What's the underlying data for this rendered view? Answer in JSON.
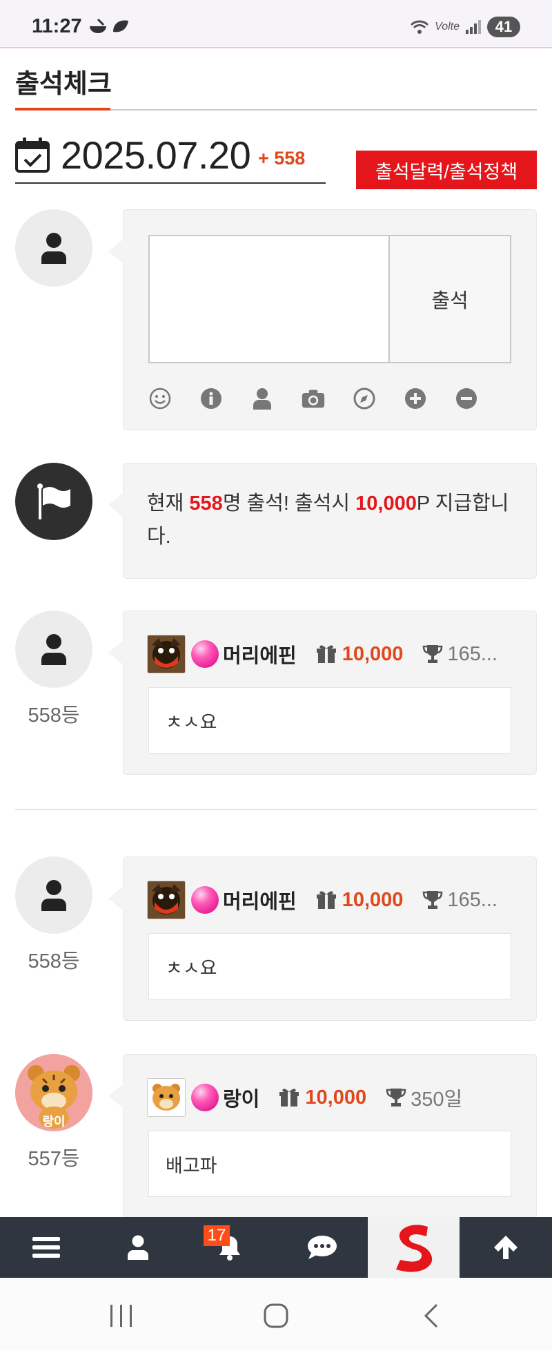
{
  "status_bar": {
    "time": "11:27",
    "volte": "Volte",
    "battery": "41"
  },
  "page": {
    "title": "출석체크",
    "date": "2025.07.20",
    "attend_count": "+ 558",
    "policy_button": "출석달력/출석정책"
  },
  "input": {
    "textarea_value": "",
    "submit_label": "출석",
    "tools": [
      "emoji-icon",
      "info-icon",
      "user-icon",
      "camera-icon",
      "compass-icon",
      "plus-circle-icon",
      "minus-circle-icon"
    ]
  },
  "notice": {
    "prefix": "현재 ",
    "count": "558",
    "mid": "명 출석! 출석시 ",
    "points": "10,000",
    "suffix": "P 지급합니다."
  },
  "entries": [
    {
      "rank": "558등",
      "nick": "머리에핀",
      "points": "10,000",
      "days": "165...",
      "message": "ㅊㅅ요",
      "avatar": "user-icon",
      "mini": "dog-avatar"
    },
    {
      "rank": "558등",
      "nick": "머리에핀",
      "points": "10,000",
      "days": "165...",
      "message": "ㅊㅅ요",
      "avatar": "user-icon",
      "mini": "dog-avatar"
    },
    {
      "rank": "557등",
      "nick": "랑이",
      "points": "10,000",
      "days": "350일",
      "message": "배고파",
      "avatar": "tiger-avatar",
      "avatar_text": "랑이",
      "mini": "tiger-avatar"
    }
  ],
  "bottom_nav": {
    "notification_badge": "17",
    "items": [
      "menu-icon",
      "user-icon",
      "bell-icon",
      "chat-icon",
      "site-logo",
      "arrow-up-icon"
    ]
  },
  "colors": {
    "accent": "#e0481c",
    "red": "#e5161b",
    "nav_bg": "#2f3640",
    "card_bg": "#f4f4f4"
  }
}
